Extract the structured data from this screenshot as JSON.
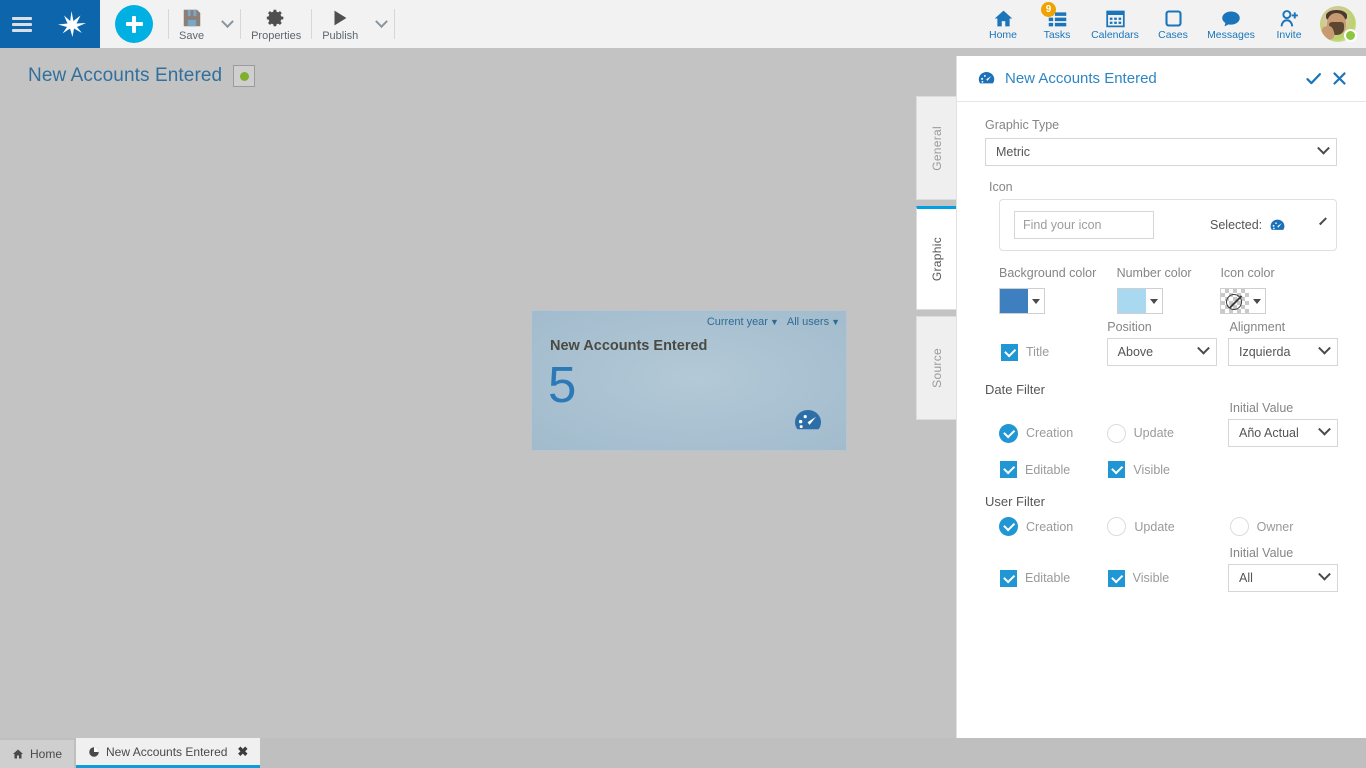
{
  "toolbar": {
    "menu_icon": "hamburger-icon",
    "logo_icon": "crowsfoot-logo",
    "add_label": "+",
    "items": [
      {
        "label": "Save",
        "icon": "floppy-disk-icon",
        "has_caret": true
      },
      {
        "label": "Properties",
        "icon": "gear-icon",
        "has_caret": false
      },
      {
        "label": "Publish",
        "icon": "play-icon",
        "has_caret": true
      }
    ],
    "nav": [
      {
        "label": "Home",
        "icon": "home-icon",
        "badge": ""
      },
      {
        "label": "Tasks",
        "icon": "tasks-icon",
        "badge": "9"
      },
      {
        "label": "Calendars",
        "icon": "calendar-icon",
        "badge": ""
      },
      {
        "label": "Cases",
        "icon": "cases-square-icon",
        "badge": ""
      },
      {
        "label": "Messages",
        "icon": "speech-bubble-icon",
        "badge": ""
      },
      {
        "label": "Invite",
        "icon": "person-add-icon",
        "badge": ""
      }
    ],
    "avatar": {
      "name": "user-avatar",
      "status": "online"
    }
  },
  "canvas": {
    "page_title": "New Accounts Entered",
    "status_indicator_color": "#7fb02a",
    "widget": {
      "title": "New Accounts Entered",
      "value": "5",
      "date_filter_label": "Current year",
      "user_filter_label": "All users",
      "icon": "speedometer-icon",
      "background_color": "#a9c1d1",
      "number_color": "#2c79b8"
    }
  },
  "vtabs": [
    {
      "label": "General",
      "active": false
    },
    {
      "label": "Graphic",
      "active": true
    },
    {
      "label": "Source",
      "active": false
    }
  ],
  "panel": {
    "title": "New Accounts Entered",
    "title_icon": "speedometer-icon",
    "confirm_icon": "check-icon",
    "close_icon": "close-x-icon",
    "graphic_type": {
      "label": "Graphic Type",
      "value": "Metric"
    },
    "icon_section": {
      "label": "Icon",
      "search_placeholder": "Find your icon",
      "search_value": "",
      "selected_label": "Selected:",
      "selected_icon": "speedometer-icon"
    },
    "colors": {
      "background": {
        "label": "Background color",
        "value": "#3d7fbf"
      },
      "number": {
        "label": "Number color",
        "value": "#a8d9f0"
      },
      "icon": {
        "label": "Icon color",
        "value": "transparent"
      }
    },
    "title_row": {
      "title_checkbox_label": "Title",
      "title_checked": true,
      "position": {
        "label": "Position",
        "value": "Above"
      },
      "alignment": {
        "label": "Alignment",
        "value": "Izquierda"
      }
    },
    "date_filter": {
      "heading": "Date Filter",
      "creation": {
        "label": "Creation",
        "selected": true
      },
      "update": {
        "label": "Update",
        "selected": false
      },
      "editable": {
        "label": "Editable",
        "checked": true
      },
      "visible": {
        "label": "Visible",
        "checked": true
      },
      "initial_value": {
        "label": "Initial Value",
        "value": "Año Actual"
      }
    },
    "user_filter": {
      "heading": "User Filter",
      "creation": {
        "label": "Creation",
        "selected": true
      },
      "update": {
        "label": "Update",
        "selected": false
      },
      "owner": {
        "label": "Owner",
        "selected": false
      },
      "editable": {
        "label": "Editable",
        "checked": true
      },
      "visible": {
        "label": "Visible",
        "checked": true
      },
      "initial_value": {
        "label": "Initial Value",
        "value": "All"
      }
    }
  },
  "taskbar": {
    "tabs": [
      {
        "label": "Home",
        "icon": "home-icon",
        "active": false,
        "closable": false
      },
      {
        "label": "New Accounts Entered",
        "icon": "pie-icon",
        "active": true,
        "closable": true,
        "close_label": "✖"
      }
    ]
  }
}
